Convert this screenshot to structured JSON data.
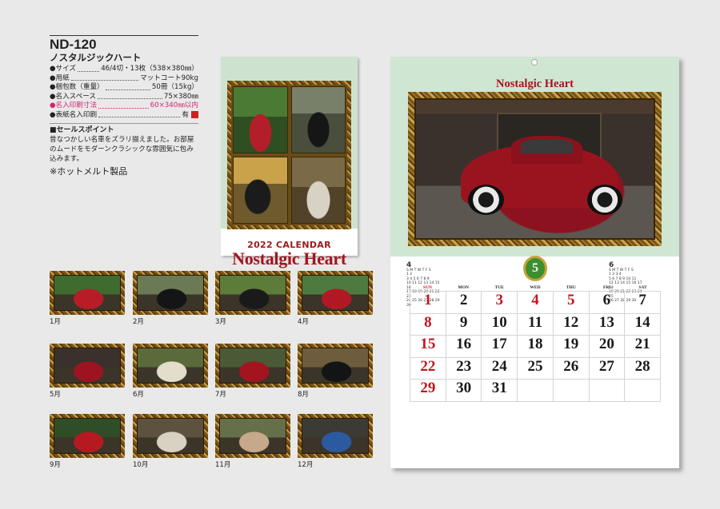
{
  "product": {
    "code": "ND-120",
    "name": "ノスタルジックハート",
    "specs": [
      {
        "key": "●サイズ",
        "value": "46/4切・13枚（538×380㎜）",
        "highlight": false
      },
      {
        "key": "●用紙",
        "value": "マットコート90kg",
        "highlight": false
      },
      {
        "key": "●梱包数（重量）",
        "value": "50冊（15kg）",
        "highlight": false
      },
      {
        "key": "●名入スペース",
        "value": "75×380㎜",
        "highlight": false
      },
      {
        "key": "●名入印刷寸法",
        "value": "60×340㎜以内",
        "highlight": true
      },
      {
        "key": "●表紙名入印刷",
        "value": "有",
        "highlight": false
      }
    ],
    "sales_point_title": "■セールスポイント",
    "sales_point_text": "昔なつかしい名車をズラリ揃えました。お部屋のムードをモダーンクラシックな雰囲気に包み込みます。",
    "hotmelt": "※ホットメルト製品"
  },
  "cover": {
    "calendar_line": "2022 CALENDAR",
    "title": "Nostalgic Heart"
  },
  "thumbnails": [
    {
      "label": "1月",
      "color": "#b71d26",
      "bg": "#3f6b2f"
    },
    {
      "label": "2月",
      "color": "#151515",
      "bg": "#6b7a55"
    },
    {
      "label": "3月",
      "color": "#1a1a1a",
      "bg": "#5d7c3a"
    },
    {
      "label": "4月",
      "color": "#b01924",
      "bg": "#4e7a3f"
    },
    {
      "label": "5月",
      "color": "#9b1420",
      "bg": "#3a302c"
    },
    {
      "label": "6月",
      "color": "#e3ddcc",
      "bg": "#5a6a3a"
    },
    {
      "label": "7月",
      "color": "#a3141f",
      "bg": "#4a5a36"
    },
    {
      "label": "8月",
      "color": "#141414",
      "bg": "#6d5d3d"
    },
    {
      "label": "9月",
      "color": "#b51a22",
      "bg": "#2f4d26"
    },
    {
      "label": "10月",
      "color": "#d9d2c2",
      "bg": "#5d5140"
    },
    {
      "label": "11月",
      "color": "#c6a98a",
      "bg": "#65704a"
    },
    {
      "label": "12月",
      "color": "#2c5aa0",
      "bg": "#3c3a35"
    }
  ],
  "calendar_page": {
    "title": "Nostalgic Heart",
    "month_badge": "5",
    "left_mini": {
      "num": "4",
      "rows": [
        "S M T W T F S",
        "1 2",
        "3 4 5 6 7 8 9",
        "10 11 12 13 14 15 16",
        "17 18 19 20 21 22 23",
        "24 25 26 27 28 29 30"
      ]
    },
    "right_mini": {
      "num": "6",
      "rows": [
        "S M T W T F S",
        "1 2 3 4",
        "5 6 7 8 9 10 11",
        "12 13 14 15 16 17 18",
        "19 20 21 22 23 24 25",
        "26 27 28 29 30"
      ]
    },
    "weekdays": [
      "SUN",
      "MON",
      "TUE",
      "WED",
      "THU",
      "FRI",
      "SAT"
    ],
    "days": [
      {
        "d": "1",
        "red": true
      },
      {
        "d": "2",
        "red": false
      },
      {
        "d": "3",
        "red": true
      },
      {
        "d": "4",
        "red": true
      },
      {
        "d": "5",
        "red": true
      },
      {
        "d": "6",
        "red": false
      },
      {
        "d": "7",
        "red": false
      },
      {
        "d": "8",
        "red": true
      },
      {
        "d": "9",
        "red": false
      },
      {
        "d": "10",
        "red": false
      },
      {
        "d": "11",
        "red": false
      },
      {
        "d": "12",
        "red": false
      },
      {
        "d": "13",
        "red": false
      },
      {
        "d": "14",
        "red": false
      },
      {
        "d": "15",
        "red": true
      },
      {
        "d": "16",
        "red": false
      },
      {
        "d": "17",
        "red": false
      },
      {
        "d": "18",
        "red": false
      },
      {
        "d": "19",
        "red": false
      },
      {
        "d": "20",
        "red": false
      },
      {
        "d": "21",
        "red": false
      },
      {
        "d": "22",
        "red": true
      },
      {
        "d": "23",
        "red": false
      },
      {
        "d": "24",
        "red": false
      },
      {
        "d": "25",
        "red": false
      },
      {
        "d": "26",
        "red": false
      },
      {
        "d": "27",
        "red": false
      },
      {
        "d": "28",
        "red": false
      },
      {
        "d": "29",
        "red": true
      },
      {
        "d": "30",
        "red": false
      },
      {
        "d": "31",
        "red": false
      },
      {
        "d": "",
        "red": false
      },
      {
        "d": "",
        "red": false
      },
      {
        "d": "",
        "red": false
      },
      {
        "d": "",
        "red": false
      }
    ]
  }
}
